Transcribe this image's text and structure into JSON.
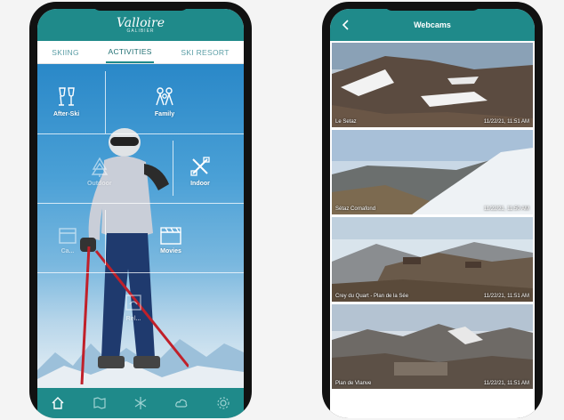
{
  "left_app": {
    "brand": {
      "name": "Valloire",
      "sub": "GALIBIER"
    },
    "tabs": [
      {
        "label": "SKIING",
        "active": false
      },
      {
        "label": "ACTIVITIES",
        "active": true
      },
      {
        "label": "SKI RESORT",
        "active": false
      }
    ],
    "tiles": [
      {
        "label": "After-Ski",
        "icon": "champagne-glasses-icon"
      },
      {
        "label": "Family",
        "icon": "family-icon"
      },
      {
        "label": "Outdoor",
        "icon": "tree-icon"
      },
      {
        "label": "Indoor",
        "icon": "indoor-icon"
      },
      {
        "label": "Ca...",
        "icon": "calendar-icon"
      },
      {
        "label": "Movies",
        "icon": "clapperboard-icon"
      },
      {
        "label": "Rel...",
        "icon": "relax-icon"
      }
    ],
    "bottom_nav": [
      "home-icon",
      "map-icon",
      "snowflake-icon",
      "weather-icon",
      "settings-icon"
    ]
  },
  "right_app": {
    "title": "Webcams",
    "webcams": [
      {
        "name": "Le Setaz",
        "time": "11/22/21, 11:51 AM"
      },
      {
        "name": "Sétaz Cornafond",
        "time": "11/22/21, 11:50 AM"
      },
      {
        "name": "Crey du Quart - Plan de la Sée",
        "time": "11/22/21, 11:51 AM"
      },
      {
        "name": "Plan de Vlanve",
        "time": "11/22/21, 11:51 AM"
      }
    ]
  },
  "colors": {
    "accent": "#1f8a8a"
  }
}
